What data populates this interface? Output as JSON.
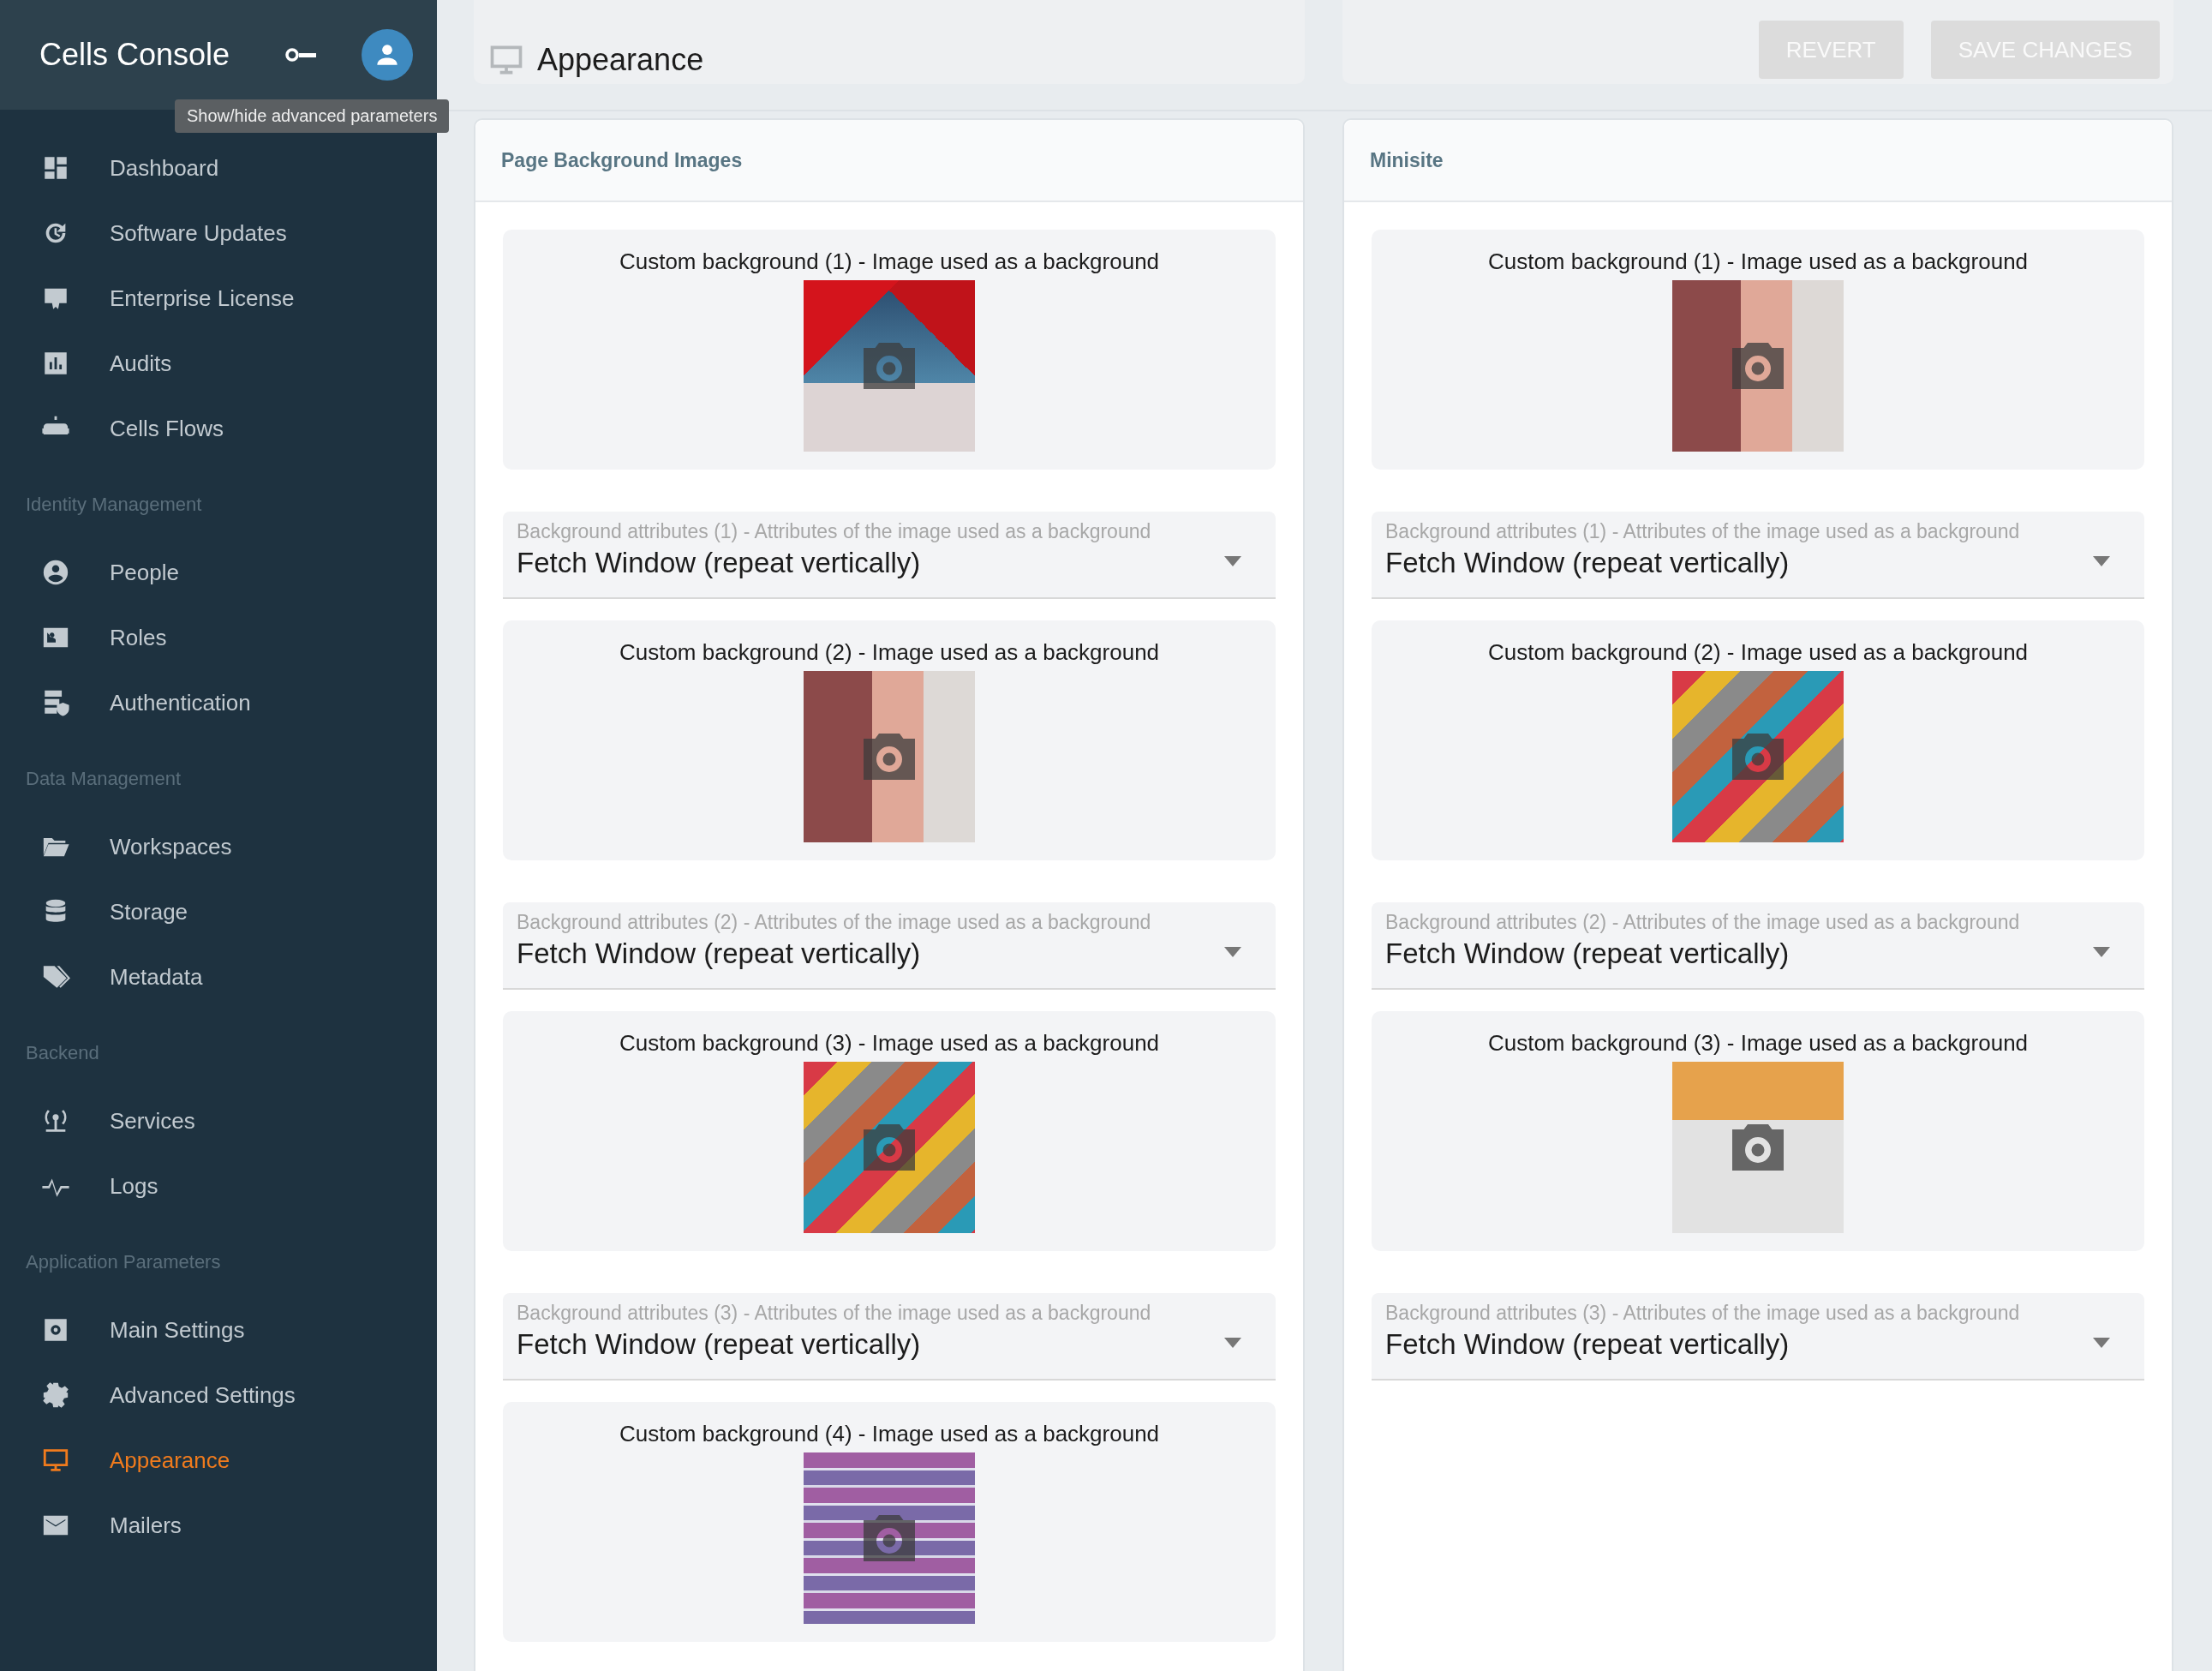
{
  "app": {
    "title": "Cells Console",
    "tooltip": "Show/hide advanced parameters"
  },
  "sidebar": {
    "sections": [
      {
        "items": [
          {
            "label": "Dashboard",
            "selected": false
          },
          {
            "label": "Software Updates",
            "selected": false
          },
          {
            "label": "Enterprise License",
            "selected": false
          },
          {
            "label": "Audits",
            "selected": false
          },
          {
            "label": "Cells Flows",
            "selected": false
          }
        ]
      },
      {
        "title": "Identity Management",
        "items": [
          {
            "label": "People",
            "selected": false
          },
          {
            "label": "Roles",
            "selected": false
          },
          {
            "label": "Authentication",
            "selected": false
          }
        ]
      },
      {
        "title": "Data Management",
        "items": [
          {
            "label": "Workspaces",
            "selected": false
          },
          {
            "label": "Storage",
            "selected": false
          },
          {
            "label": "Metadata",
            "selected": false
          }
        ]
      },
      {
        "title": "Backend",
        "items": [
          {
            "label": "Services",
            "selected": false
          },
          {
            "label": "Logs",
            "selected": false
          }
        ]
      },
      {
        "title": "Application Parameters",
        "items": [
          {
            "label": "Main Settings",
            "selected": false
          },
          {
            "label": "Advanced Settings",
            "selected": false
          },
          {
            "label": "Appearance",
            "selected": true
          },
          {
            "label": "Mailers",
            "selected": false
          }
        ]
      }
    ]
  },
  "page": {
    "title": "Appearance",
    "buttons": [
      {
        "label": "REVERT",
        "disabled": true
      },
      {
        "label": "SAVE CHANGES",
        "disabled": true
      }
    ]
  },
  "panels": [
    {
      "title": "Page Background Images",
      "fields": [
        {
          "kind": "image",
          "label": "Custom background (1) - Image used as a background"
        },
        {
          "kind": "select",
          "label": "Background attributes (1) - Attributes of the image used as a background",
          "value": "Fetch Window (repeat vertically)"
        },
        {
          "kind": "image",
          "label": "Custom background (2) - Image used as a background"
        },
        {
          "kind": "select",
          "label": "Background attributes (2) - Attributes of the image used as a background",
          "value": "Fetch Window (repeat vertically)"
        },
        {
          "kind": "image",
          "label": "Custom background (3) - Image used as a background"
        },
        {
          "kind": "select",
          "label": "Background attributes (3) - Attributes of the image used as a background",
          "value": "Fetch Window (repeat vertically)"
        },
        {
          "kind": "image",
          "label": "Custom background (4) - Image used as a background"
        }
      ]
    },
    {
      "title": "Minisite",
      "fields": [
        {
          "kind": "image",
          "label": "Custom background (1) - Image used as a background"
        },
        {
          "kind": "select",
          "label": "Background attributes (1) - Attributes of the image used as a background",
          "value": "Fetch Window (repeat vertically)"
        },
        {
          "kind": "image",
          "label": "Custom background (2) - Image used as a background"
        },
        {
          "kind": "select",
          "label": "Background attributes (2) - Attributes of the image used as a background",
          "value": "Fetch Window (repeat vertically)"
        },
        {
          "kind": "image",
          "label": "Custom background (3) - Image used as a background"
        },
        {
          "kind": "select",
          "label": "Background attributes (3) - Attributes of the image used as a background",
          "value": "Fetch Window (repeat vertically)"
        }
      ]
    }
  ]
}
